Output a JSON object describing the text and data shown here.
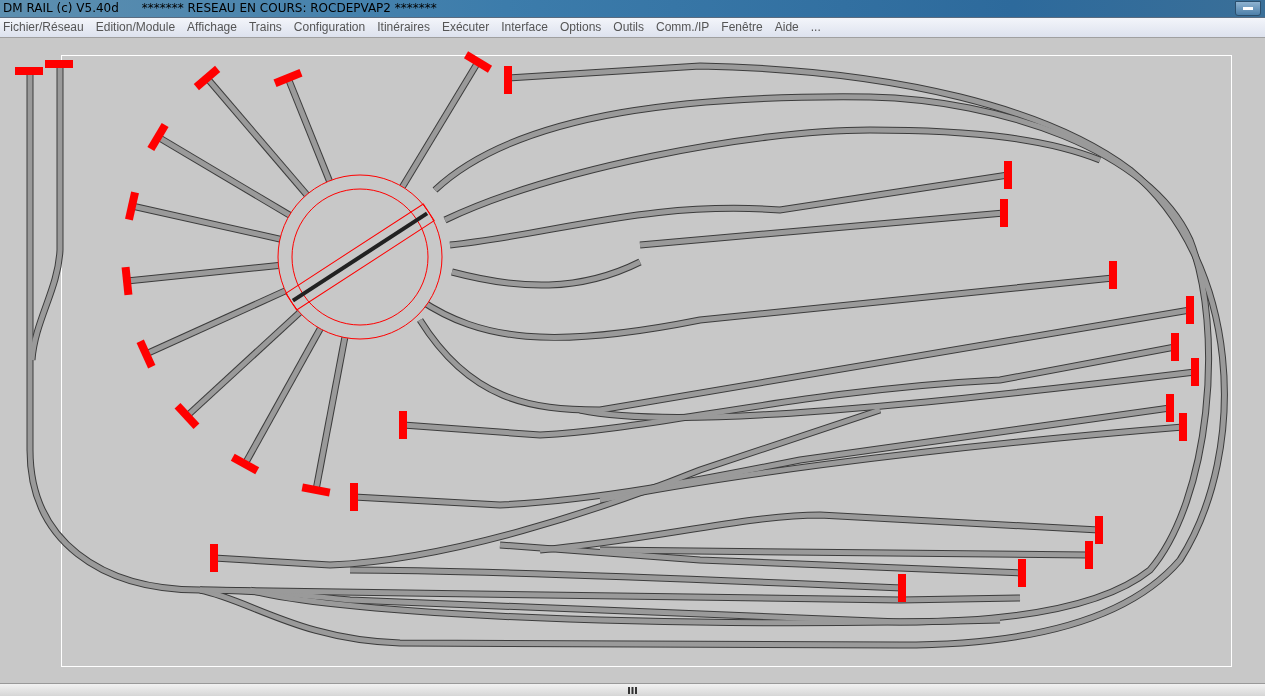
{
  "window": {
    "title": "DM RAIL (c) V5.40d      ******* RESEAU EN COURS: ROCDEPVAP2 *******"
  },
  "menu": [
    {
      "label": "Fichier/Réseau"
    },
    {
      "label": "Edition/Module"
    },
    {
      "label": "Affichage"
    },
    {
      "label": "Trains"
    },
    {
      "label": "Configuration"
    },
    {
      "label": "Itinéraires"
    },
    {
      "label": "Exécuter"
    },
    {
      "label": "Interface"
    },
    {
      "label": "Options"
    },
    {
      "label": "Outils"
    },
    {
      "label": "Comm./IP"
    },
    {
      "label": "Fenêtre"
    },
    {
      "label": "Aide"
    },
    {
      "label": "..."
    }
  ]
}
